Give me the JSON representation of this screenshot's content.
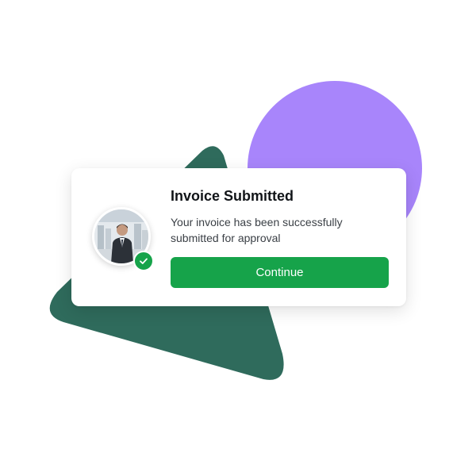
{
  "dialog": {
    "title": "Invoice Submitted",
    "message": "Your invoice has been successfully submitted for approval",
    "continue_label": "Continue"
  },
  "icons": {
    "avatar": "user-avatar",
    "badge": "check-icon"
  },
  "colors": {
    "accent": "#16a34a",
    "triangle": "#2f6b5c",
    "circle": "#a885fb",
    "card": "#ffffff",
    "title": "#111418",
    "body_text": "#3b4046"
  }
}
